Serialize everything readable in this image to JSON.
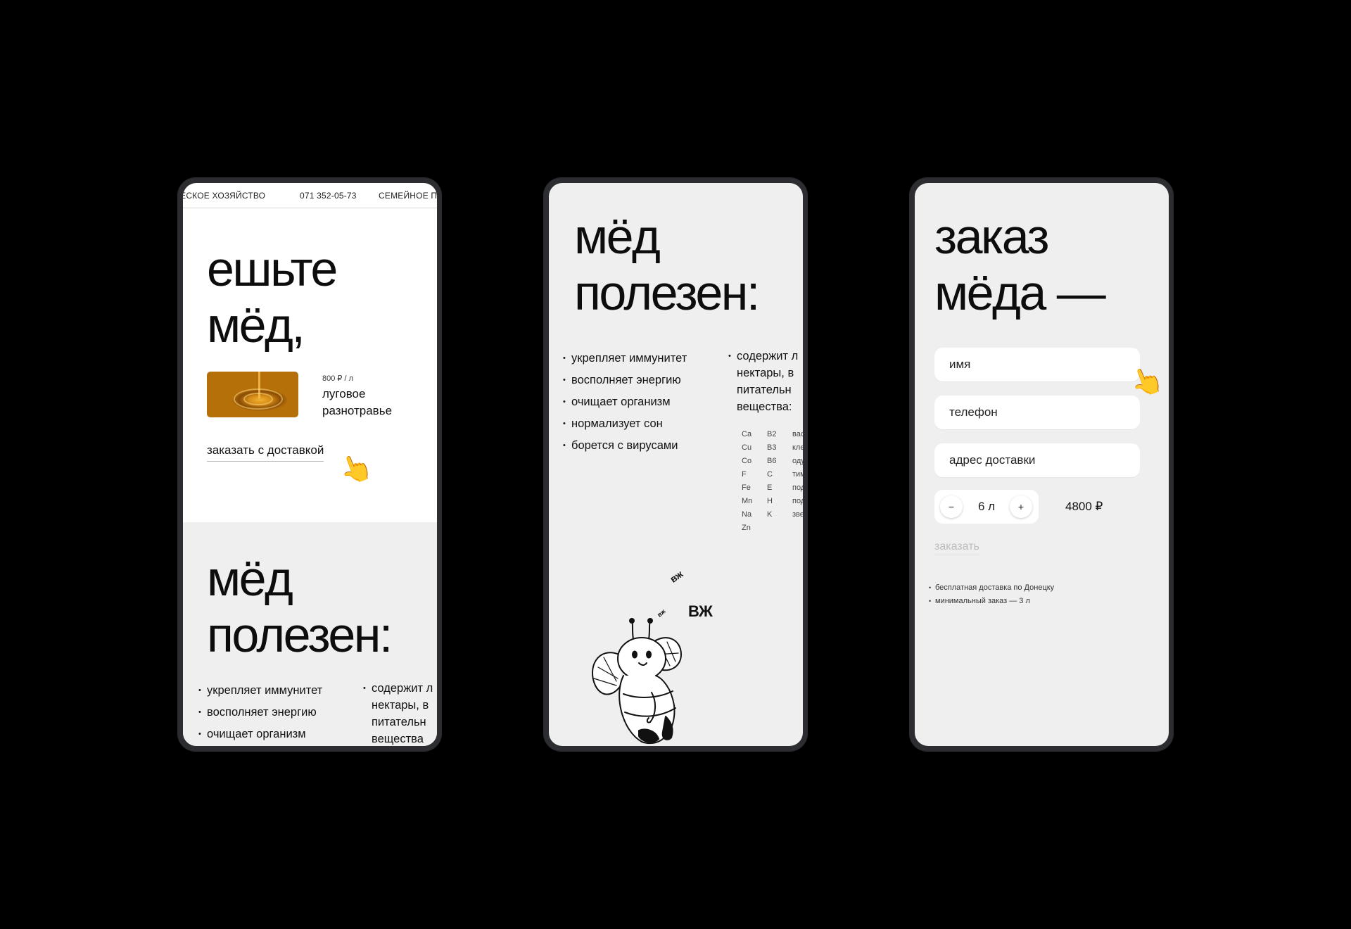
{
  "phone1": {
    "marquee": [
      "ДЧЕСКОЕ ХОЗЯЙСТВО",
      "071 352-05-73",
      "СЕМЕЙНОЕ ПЧ"
    ],
    "hero_title_line1": "ешьте",
    "hero_title_line2": "мёд,",
    "product": {
      "price": "800 ₽ / л",
      "name_line1": "луговое",
      "name_line2": "разнотравье"
    },
    "order_link": "заказать с доставкой",
    "section_title_line1": "мёд",
    "section_title_line2": "полезен:",
    "benefits": [
      "укрепляет иммунитет",
      "восполняет энергию",
      "очищает организм"
    ],
    "contains": [
      "содержит л",
      "нектары, в",
      "питательн",
      "вещества"
    ]
  },
  "phone2": {
    "title_line1": "мёд",
    "title_line2": "полезен:",
    "benefits": [
      "укрепляет иммунитет",
      "восполняет энергию",
      "очищает организм",
      "нормализует сон",
      "борется с вирусами"
    ],
    "contains": [
      "содержит л",
      "нектары, в",
      "питательн",
      "вещества:"
    ],
    "vitamins": [
      [
        "Ca",
        "B2",
        "вас"
      ],
      [
        "Cu",
        "B3",
        "кле"
      ],
      [
        "Co",
        "B6",
        "оду"
      ],
      [
        "F",
        "C",
        "тим"
      ],
      [
        "Fe",
        "E",
        "под"
      ],
      [
        "Mn",
        "H",
        "под"
      ],
      [
        "Na",
        "K",
        "звез"
      ],
      [
        "Zn",
        "",
        ""
      ]
    ],
    "buzz": [
      "вж",
      "ВЖ",
      "вж"
    ]
  },
  "phone3": {
    "title_line1": "заказ",
    "title_line2": "мёда —",
    "field_name": "имя",
    "field_phone": "телефон",
    "field_address": "адрес доставки",
    "stepper": {
      "minus": "−",
      "value": "6 л",
      "plus": "+"
    },
    "total": "4800 ₽",
    "submit": "заказать",
    "notes": [
      "бесплатная доставка по Донецку",
      "минимальный заказ — 3 л"
    ]
  },
  "icons": {
    "pointer": "pointing-hand-icon"
  },
  "colors": {
    "background": "#000000",
    "phone_frame": "#2b2d30",
    "screen_grey": "#efefef",
    "honey": "#d48a16"
  }
}
